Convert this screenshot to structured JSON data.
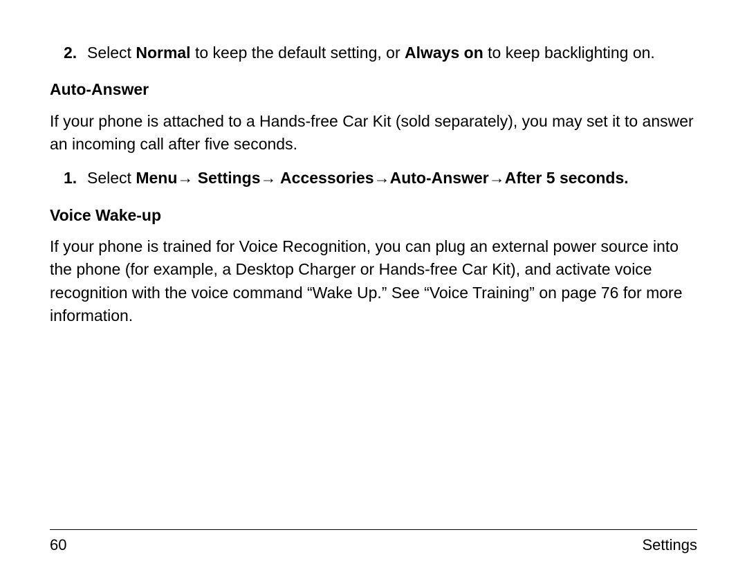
{
  "item2": {
    "number": "2.",
    "pre": "Select ",
    "b1": "Normal",
    "mid": " to keep the default setting, or ",
    "b2": "Always on",
    "post": " to keep backlighting on."
  },
  "section1": {
    "heading": "Auto-Answer",
    "para": "If your phone is attached to a Hands-free Car Kit (sold separately), you may set it to answer an incoming call after five seconds.",
    "item1": {
      "number": "1.",
      "pre": "Select ",
      "path1": "Menu",
      "path2": " Settings",
      "path3": " Accessories",
      "path4": "Auto-Answer",
      "path5": "After 5 seconds.",
      "arrow": "→"
    }
  },
  "section2": {
    "heading": "Voice Wake-up",
    "para": "If your phone is trained for Voice Recognition, you can plug an external power source into the phone (for example, a Desktop Charger or Hands-free Car Kit), and activate voice recognition with the voice command “Wake Up.” See “Voice Training” on page 76 for more information."
  },
  "footer": {
    "page": "60",
    "title": "Settings"
  }
}
